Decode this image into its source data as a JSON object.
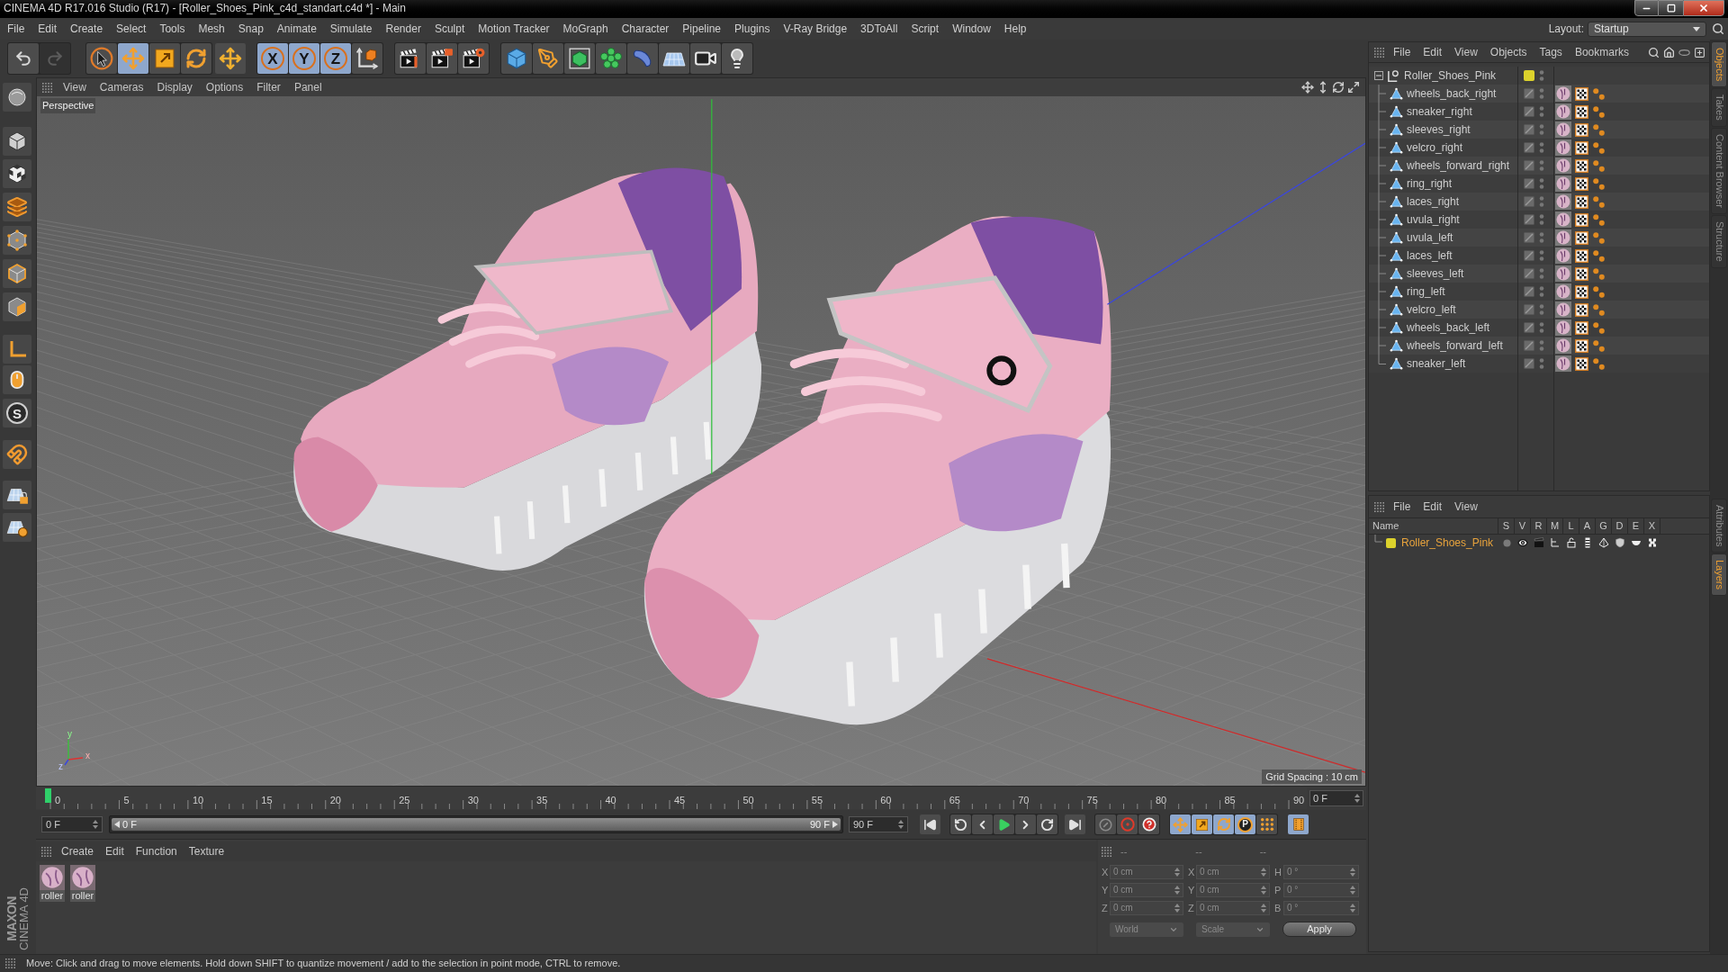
{
  "window": {
    "title": "CINEMA 4D R17.016 Studio (R17) - [Roller_Shoes_Pink_c4d_standart.c4d *] - Main"
  },
  "menu_bar": [
    "File",
    "Edit",
    "Create",
    "Select",
    "Tools",
    "Mesh",
    "Snap",
    "Animate",
    "Simulate",
    "Render",
    "Sculpt",
    "Motion Tracker",
    "MoGraph",
    "Character",
    "Pipeline",
    "Plugins",
    "V-Ray Bridge",
    "3DToAll",
    "Script",
    "Window",
    "Help"
  ],
  "layout": {
    "label": "Layout:",
    "value": "Startup"
  },
  "toolbar": [
    {
      "selected": false,
      "disabled": false
    },
    {
      "selected": false,
      "disabled": true
    },
    {
      "selected": false,
      "disabled": false
    },
    {
      "selected": true,
      "disabled": false
    },
    {
      "selected": false,
      "disabled": false
    },
    {
      "selected": false,
      "disabled": false
    },
    {
      "selected": false,
      "disabled": false
    },
    {
      "selected": true,
      "disabled": false,
      "label": "X"
    },
    {
      "selected": true,
      "disabled": false,
      "label": "Y"
    },
    {
      "selected": true,
      "disabled": false,
      "label": "Z"
    },
    {
      "selected": false,
      "disabled": false
    },
    {
      "selected": false,
      "disabled": false
    },
    {
      "selected": false,
      "disabled": false
    },
    {
      "selected": false,
      "disabled": false
    },
    {
      "selected": false,
      "disabled": false
    },
    {
      "selected": false,
      "disabled": false
    },
    {
      "selected": false,
      "disabled": false
    },
    {
      "selected": false,
      "disabled": false
    },
    {
      "selected": false,
      "disabled": false
    },
    {
      "selected": false,
      "disabled": false
    },
    {
      "selected": false,
      "disabled": false
    },
    {
      "selected": false,
      "disabled": false
    }
  ],
  "left_toolbar": {
    "snap_label": "S"
  },
  "viewport": {
    "menu": [
      "View",
      "Cameras",
      "Display",
      "Options",
      "Filter",
      "Panel"
    ],
    "camera": "Perspective",
    "grid_spacing": "Grid Spacing : 10 cm",
    "axis_labels": [
      "y",
      "x",
      "z"
    ]
  },
  "timeline": {
    "ticks": [
      "0",
      "5",
      "10",
      "15",
      "20",
      "25",
      "30",
      "35",
      "40",
      "45",
      "50",
      "55",
      "60",
      "65",
      "70",
      "75",
      "80",
      "85",
      "90"
    ],
    "level": 0,
    "current_frame": "0 F"
  },
  "transport": {
    "start_frame": "0 F",
    "range": {
      "start": "0 F",
      "end": "90 F",
      "level": 1
    },
    "end_frame": "90 F",
    "key_tracks": [
      {
        "selected": true
      },
      {
        "selected": true
      },
      {
        "selected": true
      },
      {
        "selected": true,
        "label": "P"
      },
      {
        "selected": false
      }
    ],
    "timeline_button": {
      "selected": true
    }
  },
  "material_manager": {
    "menu": [
      "Create",
      "Edit",
      "Function",
      "Texture"
    ],
    "materials": [
      {
        "name": "roller"
      },
      {
        "name": "roller"
      }
    ]
  },
  "coordinates": {
    "headers": [
      "--",
      "--",
      "--"
    ],
    "rows": [
      {
        "position_axis": "X",
        "position": "0 cm",
        "size_axis": "X",
        "size": "0 cm",
        "rotation_axis": "H",
        "rotation": "0 °"
      },
      {
        "position_axis": "Y",
        "position": "0 cm",
        "size_axis": "Y",
        "size": "0 cm",
        "rotation_axis": "P",
        "rotation": "0 °"
      },
      {
        "position_axis": "Z",
        "position": "0 cm",
        "size_axis": "Z",
        "size": "0 cm",
        "rotation_axis": "B",
        "rotation": "0 °"
      }
    ],
    "coordinate_system": "World",
    "size_mode": "Scale",
    "apply": "Apply"
  },
  "object_manager": {
    "menu": [
      "File",
      "Edit",
      "View",
      "Objects",
      "Tags",
      "Bookmarks"
    ],
    "objects": [
      {
        "name": "Roller_Shoes_Pink",
        "kind": "null",
        "color": "#dcd22c",
        "expanded": true,
        "children": [
          {
            "name": "wheels_back_right",
            "kind": "polygon"
          },
          {
            "name": "sneaker_right",
            "kind": "polygon"
          },
          {
            "name": "sleeves_right",
            "kind": "polygon"
          },
          {
            "name": "velcro_right",
            "kind": "polygon"
          },
          {
            "name": "wheels_forward_right",
            "kind": "polygon"
          },
          {
            "name": "ring_right",
            "kind": "polygon"
          },
          {
            "name": "laces_right",
            "kind": "polygon"
          },
          {
            "name": "uvula_right",
            "kind": "polygon"
          },
          {
            "name": "uvula_left",
            "kind": "polygon"
          },
          {
            "name": "laces_left",
            "kind": "polygon"
          },
          {
            "name": "sleeves_left",
            "kind": "polygon"
          },
          {
            "name": "ring_left",
            "kind": "polygon"
          },
          {
            "name": "velcro_left",
            "kind": "polygon"
          },
          {
            "name": "wheels_back_left",
            "kind": "polygon"
          },
          {
            "name": "wheels_forward_left",
            "kind": "polygon"
          },
          {
            "name": "sneaker_left",
            "kind": "polygon"
          }
        ]
      }
    ]
  },
  "layer_manager": {
    "menu": [
      "File",
      "Edit",
      "View"
    ],
    "columns": [
      "Name",
      "S",
      "V",
      "R",
      "M",
      "L",
      "A",
      "G",
      "D",
      "E",
      "X"
    ],
    "layers": [
      {
        "name": "Roller_Shoes_Pink",
        "color": "#dcd22c"
      }
    ]
  },
  "side_tabs": {
    "upper": [
      {
        "label": "Objects",
        "selected": true
      },
      {
        "label": "Takes",
        "selected": false
      },
      {
        "label": "Content Browser",
        "selected": false
      },
      {
        "label": "Structure",
        "selected": false
      }
    ],
    "lower": [
      {
        "label": "Attributes",
        "selected": false
      },
      {
        "label": "Layers",
        "selected": true
      }
    ]
  },
  "logo": {
    "brand": "MAXON",
    "product": "CINEMA 4D"
  },
  "status_bar": "Move: Click and drag to move elements. Hold down SHIFT to quantize movement / add to the selection in point mode, CTRL to remove."
}
